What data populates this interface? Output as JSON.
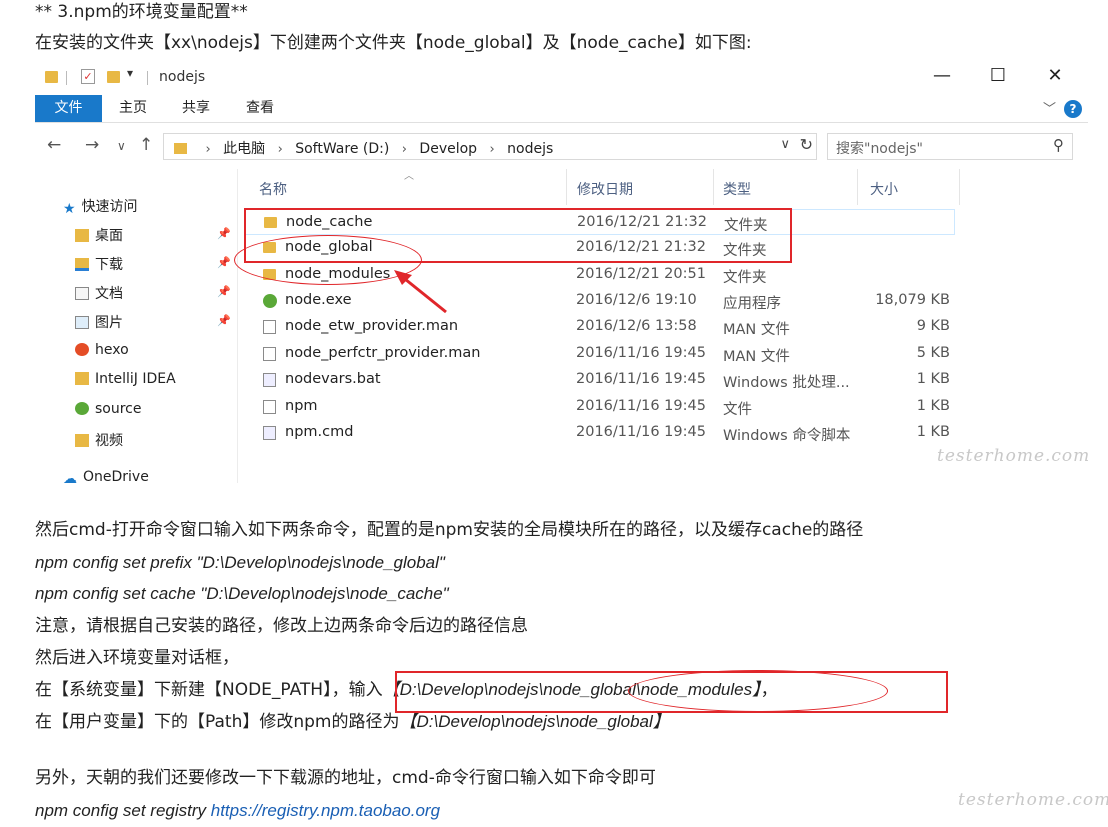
{
  "article": {
    "heading": "** 3.npm的环境变量配置**",
    "intro": "在安装的文件夹【xx\\nodejs】下创建两个文件夹【node_global】及【node_cache】如下图:",
    "p1": "然后cmd-打开命令窗口输入如下两条命令，配置的是npm安装的全局模块所在的路径，以及缓存cache的路径",
    "cmd1": "npm config set prefix \"D:\\Develop\\nodejs\\node_global\"",
    "cmd2": "npm config set cache \"D:\\Develop\\nodejs\\node_cache\"",
    "p2": "注意，请根据自己安装的路径，修改上边两条命令后边的路径信息",
    "p3": "然后进入环境变量对话框，",
    "p4_prefix": "在【系统变量】下新建【NODE_PATH】，",
    "p4_input_label": "输入",
    "p4_path": "【D:\\Develop\\nodejs\\node_global\\node_modules】",
    "p4_suffix": "，",
    "p5_prefix": "在【用户变量】下的【Path】修改npm的路径为",
    "p5_path": "【D:\\Develop\\nodejs\\node_global】",
    "p6": "另外，天朝的我们还要修改一下下载源的地址，cmd-命令行窗口输入如下命令即可",
    "cmd3_prefix": "npm config set registry ",
    "cmd3_link": "https://registry.npm.taobao.org"
  },
  "explorer": {
    "title": "nodejs",
    "ribbon_tabs": [
      "文件",
      "主页",
      "共享",
      "查看"
    ],
    "breadcrumbs": [
      "此电脑",
      "SoftWare (D:)",
      "Develop",
      "nodejs"
    ],
    "search_placeholder": "搜索\"nodejs\"",
    "columns": [
      "名称",
      "修改日期",
      "类型",
      "大小"
    ],
    "nav_items": [
      {
        "label": "快速访问",
        "icon": "star-icon",
        "pinned": false
      },
      {
        "label": "桌面",
        "icon": "folder-icon",
        "pinned": true
      },
      {
        "label": "下载",
        "icon": "download-folder-icon",
        "pinned": true
      },
      {
        "label": "文档",
        "icon": "documents-icon",
        "pinned": true
      },
      {
        "label": "图片",
        "icon": "pictures-icon",
        "pinned": true
      },
      {
        "label": "hexo",
        "icon": "app-icon",
        "pinned": false
      },
      {
        "label": "IntelliJ IDEA",
        "icon": "folder-icon",
        "pinned": false
      },
      {
        "label": "source",
        "icon": "app-icon",
        "pinned": false
      },
      {
        "label": "视频",
        "icon": "folder-icon",
        "pinned": false
      },
      {
        "label": "OneDrive",
        "icon": "cloud-icon",
        "pinned": false
      }
    ],
    "files": [
      {
        "name": "node_cache",
        "date": "2016/12/21 21:32",
        "type": "文件夹",
        "size": "",
        "icon": "folder"
      },
      {
        "name": "node_global",
        "date": "2016/12/21 21:32",
        "type": "文件夹",
        "size": "",
        "icon": "folder"
      },
      {
        "name": "node_modules",
        "date": "2016/12/21 20:51",
        "type": "文件夹",
        "size": "",
        "icon": "folder"
      },
      {
        "name": "node.exe",
        "date": "2016/12/6 19:10",
        "type": "应用程序",
        "size": "18,079 KB",
        "icon": "exe"
      },
      {
        "name": "node_etw_provider.man",
        "date": "2016/12/6 13:58",
        "type": "MAN 文件",
        "size": "9 KB",
        "icon": "file"
      },
      {
        "name": "node_perfctr_provider.man",
        "date": "2016/11/16 19:45",
        "type": "MAN 文件",
        "size": "5 KB",
        "icon": "file"
      },
      {
        "name": "nodevars.bat",
        "date": "2016/11/16 19:45",
        "type": "Windows 批处理...",
        "size": "1 KB",
        "icon": "bat"
      },
      {
        "name": "npm",
        "date": "2016/11/16 19:45",
        "type": "文件",
        "size": "1 KB",
        "icon": "file"
      },
      {
        "name": "npm.cmd",
        "date": "2016/11/16 19:45",
        "type": "Windows 命令脚本",
        "size": "1 KB",
        "icon": "bat"
      }
    ]
  },
  "watermark": "testerhome.com",
  "colors": {
    "accent": "#1979ca",
    "annotation": "#e0262a",
    "link": "#1a5fb4",
    "folder": "#e8b844"
  }
}
